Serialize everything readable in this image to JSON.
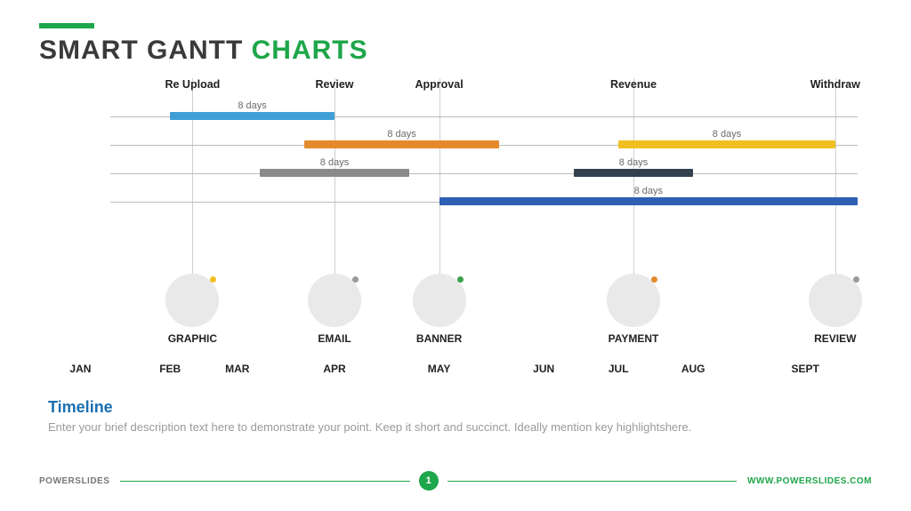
{
  "title": {
    "part1": "SMART GANTT ",
    "part2": "CHARTS"
  },
  "chart_data": {
    "type": "bar",
    "orientation": "horizontal-gantt",
    "x_axis_months": [
      "JAN",
      "FEB",
      "MAR",
      "APR",
      "MAY",
      "JUN",
      "JUL",
      "AUG",
      "SEPT"
    ],
    "phases": [
      {
        "label": "Re Upload",
        "pos_pct": 11
      },
      {
        "label": "Review",
        "pos_pct": 30
      },
      {
        "label": "Approval",
        "pos_pct": 44
      },
      {
        "label": "Revenue",
        "pos_pct": 70
      },
      {
        "label": "Withdraw",
        "pos_pct": 97
      }
    ],
    "rows": [
      {
        "bars": [
          {
            "label": "8 days",
            "start_pct": 8,
            "end_pct": 30,
            "color": "#3f9fd6"
          }
        ]
      },
      {
        "bars": [
          {
            "label": "8 days",
            "start_pct": 26,
            "end_pct": 52,
            "color": "#e58a2c"
          },
          {
            "label": "8 days",
            "start_pct": 68,
            "end_pct": 97,
            "color": "#f2bf22"
          }
        ]
      },
      {
        "bars": [
          {
            "label": "8 days",
            "start_pct": 20,
            "end_pct": 40,
            "color": "#8a8a8a"
          },
          {
            "label": "8 days",
            "start_pct": 62,
            "end_pct": 78,
            "color": "#33414f"
          }
        ]
      },
      {
        "bars": [
          {
            "label": "8 days",
            "start_pct": 44,
            "end_pct": 100,
            "color": "#2f5fb3"
          }
        ]
      }
    ],
    "bubbles": [
      {
        "label": "GRAPHIC",
        "pos_pct": 11,
        "dot_color": "#f2bf22"
      },
      {
        "label": "EMAIL",
        "pos_pct": 30,
        "dot_color": "#9a9a9a"
      },
      {
        "label": "BANNER",
        "pos_pct": 44,
        "dot_color": "#3aa24a"
      },
      {
        "label": "PAYMENT",
        "pos_pct": 70,
        "dot_color": "#e58a2c"
      },
      {
        "label": "REVIEW",
        "pos_pct": 97,
        "dot_color": "#9a9a9a"
      }
    ],
    "months_layout": [
      {
        "label": "JAN",
        "pos_pct": -4
      },
      {
        "label": "FEB",
        "pos_pct": 8
      },
      {
        "label": "MAR",
        "pos_pct": 17
      },
      {
        "label": "APR",
        "pos_pct": 30
      },
      {
        "label": "MAY",
        "pos_pct": 44
      },
      {
        "label": "JUN",
        "pos_pct": 58
      },
      {
        "label": "JUL",
        "pos_pct": 68
      },
      {
        "label": "AUG",
        "pos_pct": 78
      },
      {
        "label": "SEPT",
        "pos_pct": 93
      }
    ]
  },
  "subtitle": {
    "heading": "Timeline",
    "body": "Enter your brief description text here to demonstrate your point. Keep it short and succinct. Ideally mention key highlightshere."
  },
  "footer": {
    "brand_left": "POWERSLIDES",
    "page": "1",
    "brand_right": "WWW.POWERSLIDES.COM"
  }
}
